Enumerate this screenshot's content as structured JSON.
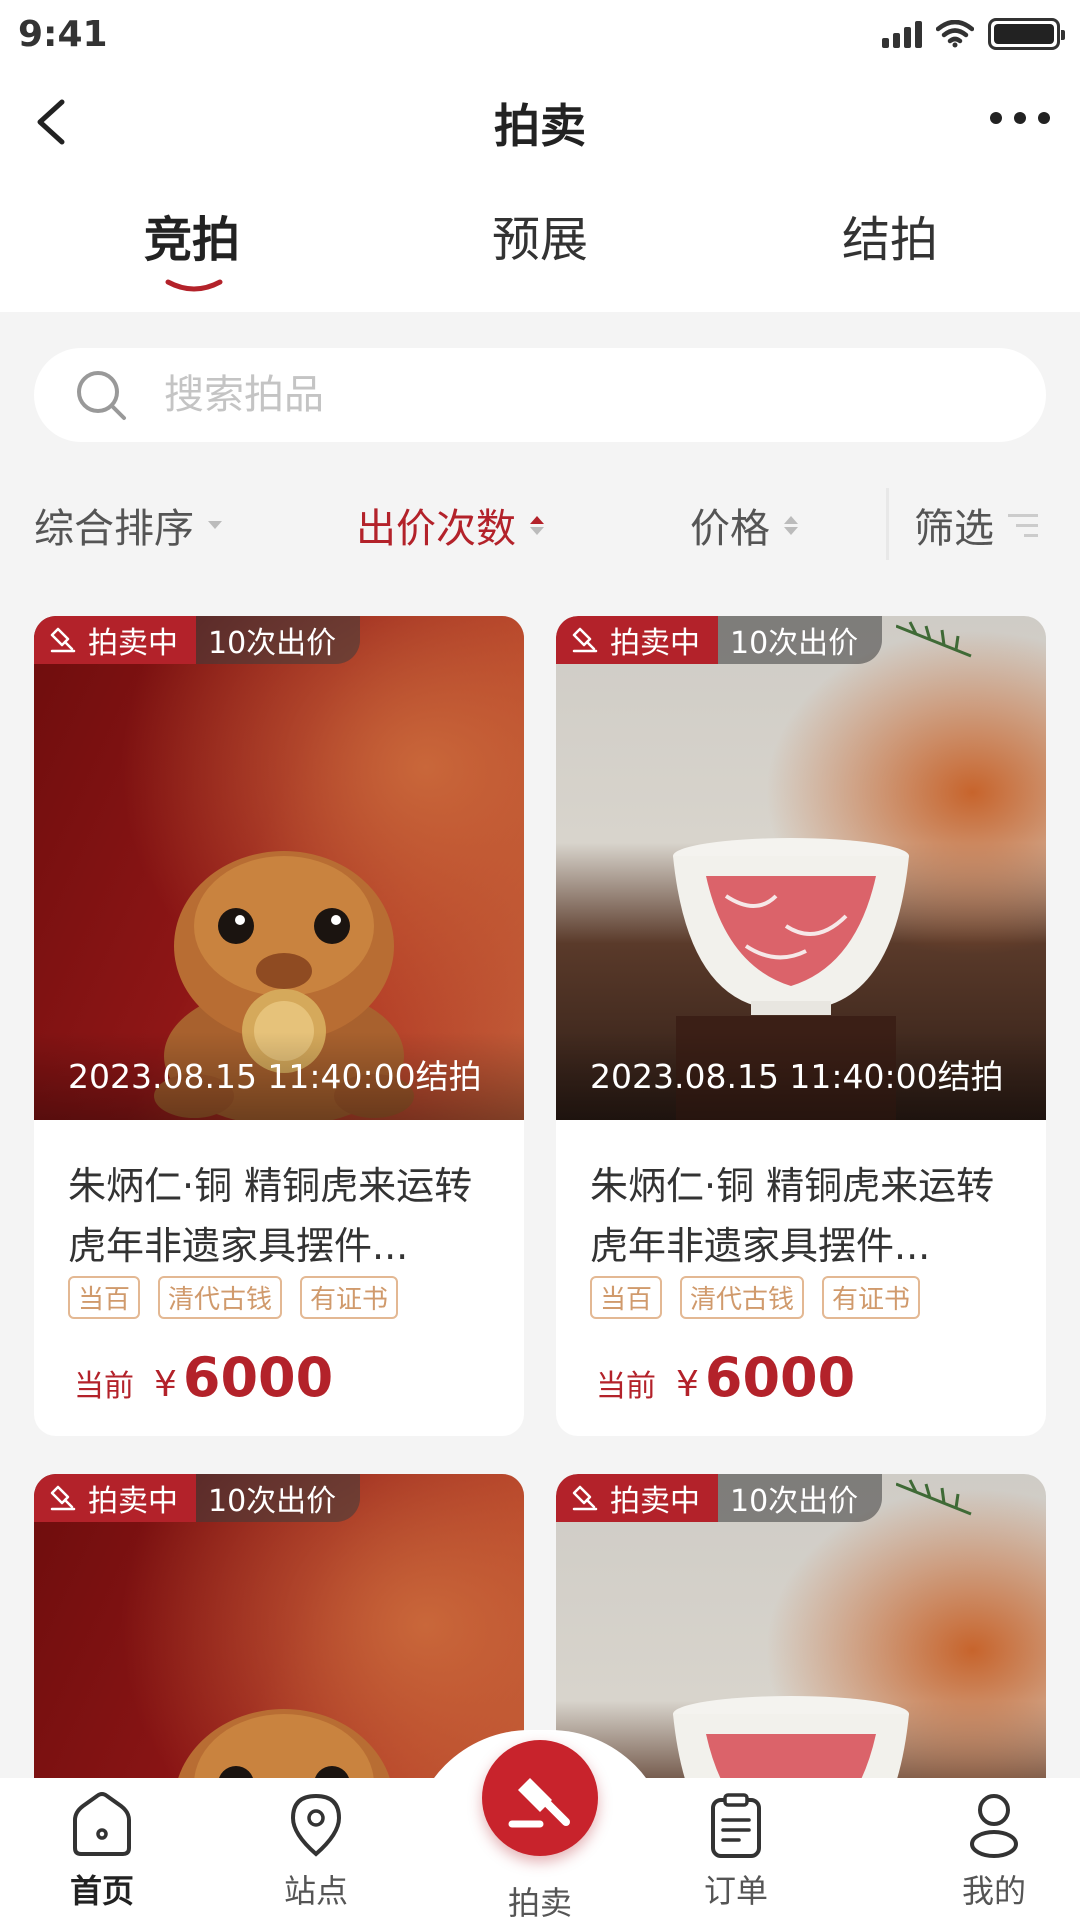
{
  "status_bar": {
    "time": "9:41"
  },
  "nav": {
    "title": "拍卖"
  },
  "tabs": [
    {
      "label": "竞拍",
      "active": true
    },
    {
      "label": "预展",
      "active": false
    },
    {
      "label": "结拍",
      "active": false
    }
  ],
  "search": {
    "placeholder": "搜索拍品",
    "value": ""
  },
  "sort": {
    "overall": "综合排序",
    "bid_count": "出价次数",
    "price": "价格",
    "filter": "筛选",
    "active": "bid_count"
  },
  "products": [
    {
      "status": "拍卖中",
      "bids": "10次出价",
      "end_time": "2023.08.15 11:40:00结拍",
      "title": "朱炳仁·铜 精铜虎来运转虎年非遗家具摆件...",
      "tags": [
        "当百",
        "清代古钱",
        "有证书"
      ],
      "price_label": "当前",
      "currency": "¥",
      "price": "6000",
      "image": "bronze-tiger"
    },
    {
      "status": "拍卖中",
      "bids": "10次出价",
      "end_time": "2023.08.15 11:40:00结拍",
      "title": "朱炳仁·铜 精铜虎来运转虎年非遗家具摆件...",
      "tags": [
        "当百",
        "清代古钱",
        "有证书"
      ],
      "price_label": "当前",
      "currency": "¥",
      "price": "6000",
      "image": "porcelain-cup"
    },
    {
      "status": "拍卖中",
      "bids": "10次出价",
      "image": "bronze-tiger"
    },
    {
      "status": "拍卖中",
      "bids": "10次出价",
      "image": "porcelain-cup"
    }
  ],
  "tab_bar": {
    "items": [
      {
        "label": "首页",
        "icon": "home-icon",
        "active": true
      },
      {
        "label": "站点",
        "icon": "location-icon",
        "active": false
      },
      {
        "label": "拍卖",
        "icon": "gavel-icon",
        "active": false
      },
      {
        "label": "订单",
        "icon": "clipboard-icon",
        "active": false
      },
      {
        "label": "我的",
        "icon": "user-icon",
        "active": false
      }
    ]
  },
  "colors": {
    "brand": "#b3222a",
    "tag_border": "#e3b893",
    "tag_text": "#d09a6c",
    "background": "#f4f4f4"
  }
}
